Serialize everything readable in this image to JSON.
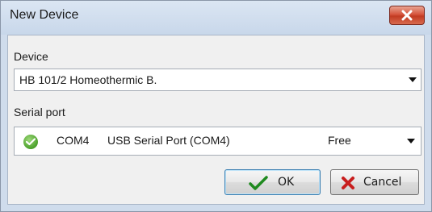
{
  "window": {
    "title": "New Device"
  },
  "device": {
    "label": "Device",
    "selected": "HB 101/2 Homeothermic B."
  },
  "serial_port": {
    "label": "Serial port",
    "port": "COM4",
    "description": "USB Serial Port (COM4)",
    "status": "Free",
    "status_icon": "check-circle-icon"
  },
  "buttons": {
    "ok_label": "OK",
    "cancel_label": "Cancel"
  },
  "colors": {
    "close_button": "#c8442b",
    "ok_check": "#1f8a1f",
    "cancel_x": "#c81e1e",
    "port_ok": "#4aa02a"
  }
}
